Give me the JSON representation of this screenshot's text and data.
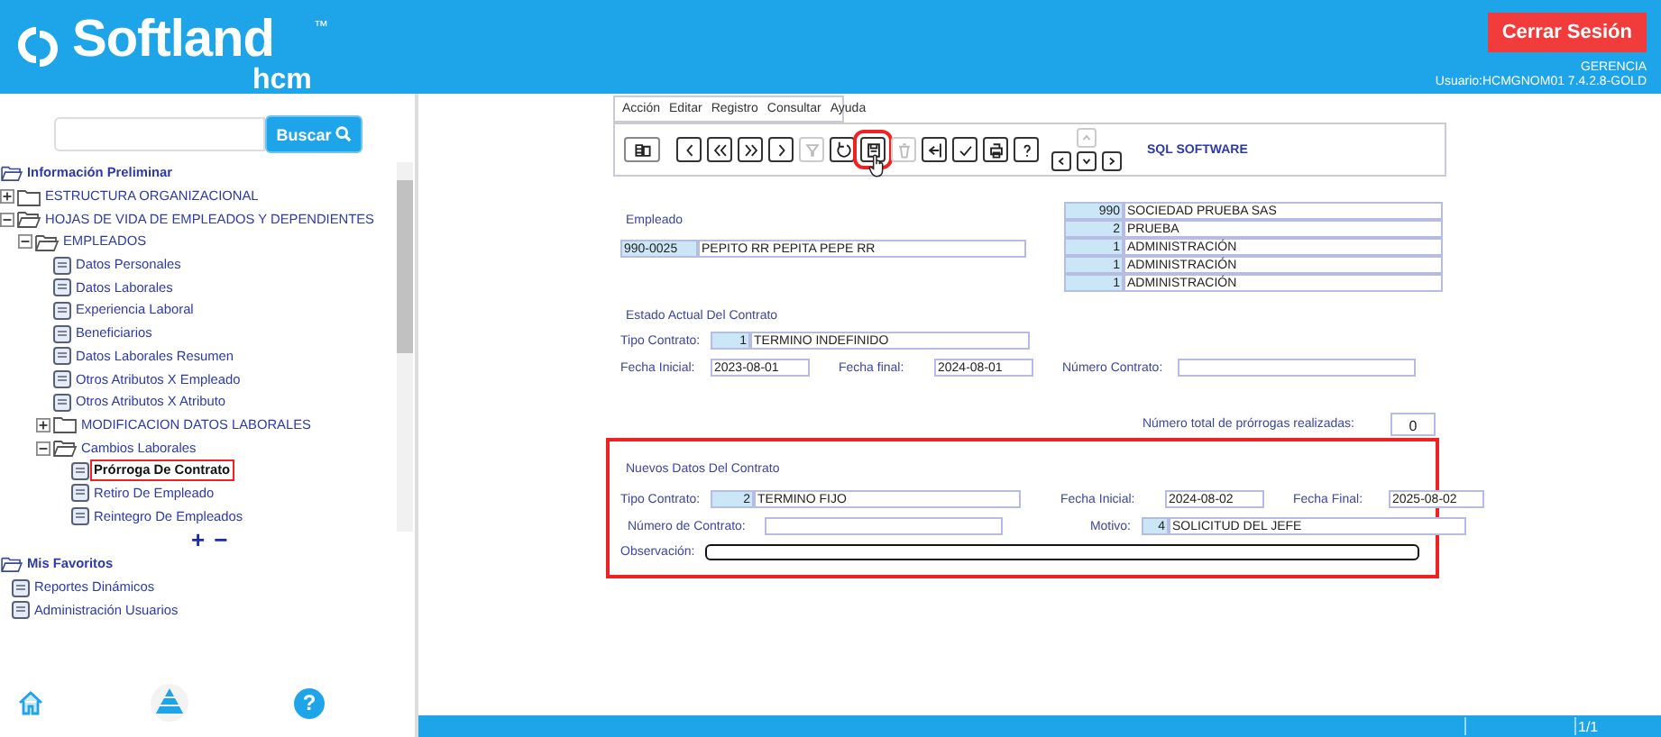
{
  "header": {
    "logo": "Softland",
    "logo_tm": "™",
    "logo_sub": "hcm",
    "logout_button": "Cerrar Sesión",
    "company": "GERENCIA",
    "user": "Usuario:HCMGNOM01 7.4.2.8-GOLD"
  },
  "search": {
    "button": "Buscar"
  },
  "tree": {
    "title": "Información Preliminar",
    "items": [
      {
        "label": "ESTRUCTURA ORGANIZACIONAL",
        "kind": "folder",
        "expanded": false,
        "selected": false
      },
      {
        "label": "HOJAS DE VIDA DE EMPLEADOS Y DEPENDIENTES",
        "kind": "folder",
        "expanded": true,
        "selected": false,
        "children": [
          {
            "label": "EMPLEADOS",
            "kind": "folder",
            "expanded": true,
            "selected": false,
            "children": [
              {
                "label": "Datos Personales",
                "kind": "page",
                "selected": false
              },
              {
                "label": "Datos Laborales",
                "kind": "page",
                "selected": false
              },
              {
                "label": "Experiencia Laboral",
                "kind": "page",
                "selected": false
              },
              {
                "label": "Beneficiarios",
                "kind": "page",
                "selected": false
              },
              {
                "label": "Datos Laborales Resumen",
                "kind": "page",
                "selected": false
              },
              {
                "label": "Otros Atributos X Empleado",
                "kind": "page",
                "selected": false
              },
              {
                "label": "Otros Atributos X Atributo",
                "kind": "page",
                "selected": false
              },
              {
                "label": "MODIFICACION DATOS LABORALES",
                "kind": "folder",
                "expanded": false,
                "selected": false
              },
              {
                "label": "Cambios Laborales",
                "kind": "folder",
                "expanded": true,
                "selected": false,
                "children": [
                  {
                    "label": "Prórroga De Contrato",
                    "kind": "page",
                    "selected": true
                  },
                  {
                    "label": "Retiro De Empleado",
                    "kind": "page",
                    "selected": false
                  },
                  {
                    "label": "Reintegro De Empleados",
                    "kind": "page",
                    "selected": false
                  }
                ]
              }
            ]
          }
        ]
      }
    ]
  },
  "tree_zoom": [
    "+",
    "−"
  ],
  "favorites": {
    "title": "Mis Favoritos",
    "items": [
      {
        "label": "Reportes Dinámicos",
        "kind": "page",
        "selected": false
      },
      {
        "label": "Administración Usuarios",
        "kind": "page",
        "selected": false
      }
    ]
  },
  "help_button": "?",
  "menu": [
    "Acción",
    "Editar",
    "Registro",
    "Consultar",
    "Ayuda"
  ],
  "toolbar": {
    "label": "SQL SOFTWARE",
    "buttons": [
      {
        "kind": "grid",
        "disabled": false,
        "selected": false
      },
      {
        "kind": "prev",
        "disabled": false,
        "selected": false
      },
      {
        "kind": "first",
        "disabled": false,
        "selected": false
      },
      {
        "kind": "last",
        "disabled": false,
        "selected": false
      },
      {
        "kind": "next",
        "disabled": false,
        "selected": false
      },
      {
        "kind": "filter",
        "disabled": true,
        "selected": false
      },
      {
        "kind": "undo",
        "disabled": false,
        "selected": false
      },
      {
        "kind": "save",
        "disabled": false,
        "selected": true
      },
      {
        "kind": "trash",
        "disabled": true,
        "selected": false
      },
      {
        "kind": "exit",
        "disabled": false,
        "selected": false
      },
      {
        "kind": "approve",
        "disabled": false,
        "selected": false
      },
      {
        "kind": "print",
        "disabled": false,
        "selected": false
      },
      {
        "kind": "help",
        "disabled": false,
        "selected": false
      }
    ],
    "nav_buttons": [
      {
        "kind": "up",
        "disabled": true
      },
      {
        "kind": "left",
        "disabled": false
      },
      {
        "kind": "down",
        "disabled": false
      },
      {
        "kind": "right",
        "disabled": false
      }
    ]
  },
  "employee": {
    "label": "Empleado",
    "code": "990-0025",
    "name": "PEPITO RR PEPITA PEPE RR"
  },
  "org_units": [
    {
      "code": "990",
      "name": "SOCIEDAD  PRUEBA SAS"
    },
    {
      "code": "2",
      "name": "PRUEBA"
    },
    {
      "code": "1",
      "name": "ADMINISTRACIÓN"
    },
    {
      "code": "1",
      "name": "ADMINISTRACIÓN"
    },
    {
      "code": "1",
      "name": "ADMINISTRACIÓN"
    }
  ],
  "current_contract": {
    "title": "Estado Actual Del Contrato",
    "type_label": "Tipo Contrato:",
    "type_code": "1",
    "type_name": "TERMINO INDEFINIDO",
    "start_label": "Fecha Inicial:",
    "start": "2023-08-01",
    "end_label": "Fecha final:",
    "end": "2024-08-01",
    "number_label": "Número Contrato:"
  },
  "extensions": {
    "label": "Número total de prórrogas realizadas:",
    "value": "0"
  },
  "new_contract": {
    "title": "Nuevos Datos Del Contrato",
    "highlighted": true,
    "type_label": "Tipo Contrato:",
    "type_code": "2",
    "type_name": "TERMINO FIJO",
    "start_label": "Fecha Inicial:",
    "start": "2024-08-02",
    "end_label": "Fecha Final:",
    "end": "2025-08-02",
    "number_label": "Número de Contrato:",
    "reason_label": "Motivo:",
    "reason_code": "4",
    "reason_name": "SOLICITUD DEL JEFE",
    "note_label": "Observación:"
  },
  "status_bar": {
    "page": "1/1"
  }
}
